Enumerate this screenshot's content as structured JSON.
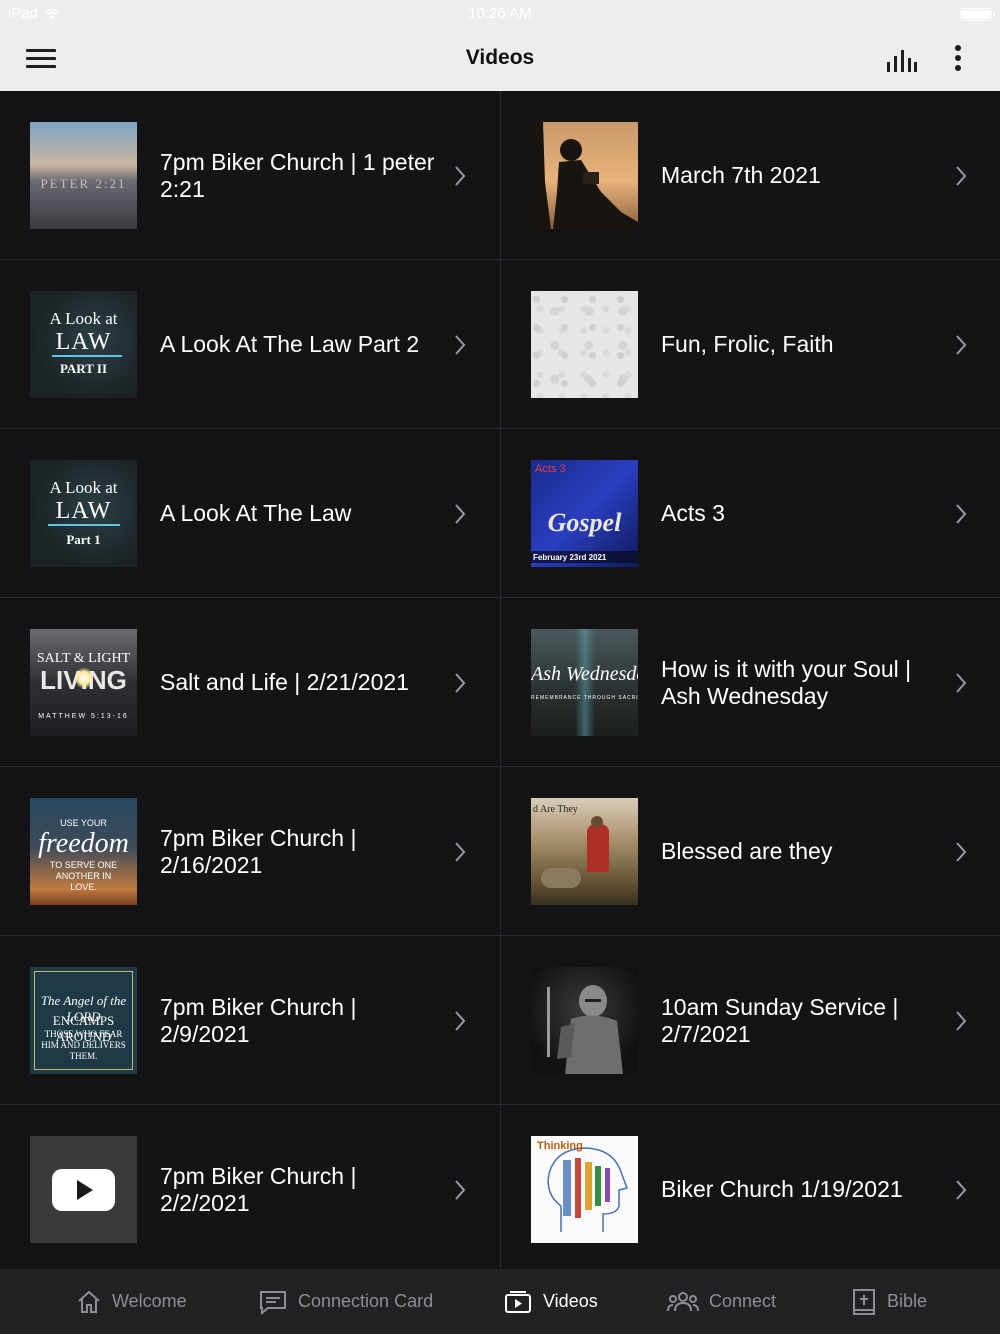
{
  "status_bar": {
    "carrier": "iPad",
    "time": "10:26 AM"
  },
  "nav": {
    "title": "Videos"
  },
  "videos": [
    {
      "title": "7pm Biker Church | 1 peter 2:21",
      "thumb_text": "PETER 2:21"
    },
    {
      "title": "March 7th 2021"
    },
    {
      "title": "A Look At The Law Part 2",
      "thumb_line1": "A Look at",
      "thumb_line2": "LAW",
      "thumb_line3": "PART II"
    },
    {
      "title": "Fun, Frolic, Faith"
    },
    {
      "title": "A Look At The Law",
      "thumb_line1": "A Look at",
      "thumb_line2": "LAW",
      "thumb_line3": "Part 1"
    },
    {
      "title": "Acts 3",
      "thumb_line1": "Acts 3",
      "thumb_line2": "Gospel",
      "thumb_line3": "February 23rd 2021"
    },
    {
      "title": "Salt and Life | 2/21/2021",
      "thumb_line1": "SALT & LIGHT",
      "thumb_line2": "LIVING",
      "thumb_line3": "MATTHEW 5:13-16"
    },
    {
      "title": "How is it with your Soul | Ash Wednesday",
      "thumb_line1": "Ash Wednesday",
      "thumb_line2": "REMEMBRANCE  THROUGH  SACRIFICE"
    },
    {
      "title": "7pm Biker Church | 2/16/2021",
      "thumb_line1": "USE YOUR",
      "thumb_line2": "freedom",
      "thumb_line3": "TO SERVE ONE ANOTHER IN LOVE."
    },
    {
      "title": "Blessed are they",
      "thumb_line1": "d Are They"
    },
    {
      "title": "7pm Biker Church | 2/9/2021",
      "thumb_line1": "The Angel of the LORD",
      "thumb_line2": "ENCAMPS AROUND",
      "thumb_line3": "THOSE WHO FEAR HIM AND DELIVERS THEM."
    },
    {
      "title": "10am Sunday Service | 2/7/2021"
    },
    {
      "title": "7pm Biker Church | 2/2/2021"
    },
    {
      "title": "Biker Church 1/19/2021",
      "thumb_line1": "Thinking"
    }
  ],
  "tabs": [
    {
      "label": "Welcome",
      "icon": "home-icon"
    },
    {
      "label": "Connection Card",
      "icon": "card-icon"
    },
    {
      "label": "Videos",
      "icon": "video-icon",
      "active": true
    },
    {
      "label": "Connect",
      "icon": "people-icon"
    },
    {
      "label": "Bible",
      "icon": "bible-icon"
    }
  ],
  "colors": {
    "background": "#141416",
    "nav": "#ededed",
    "tab_bar": "#222225",
    "tab_inactive": "#8e8e93"
  }
}
